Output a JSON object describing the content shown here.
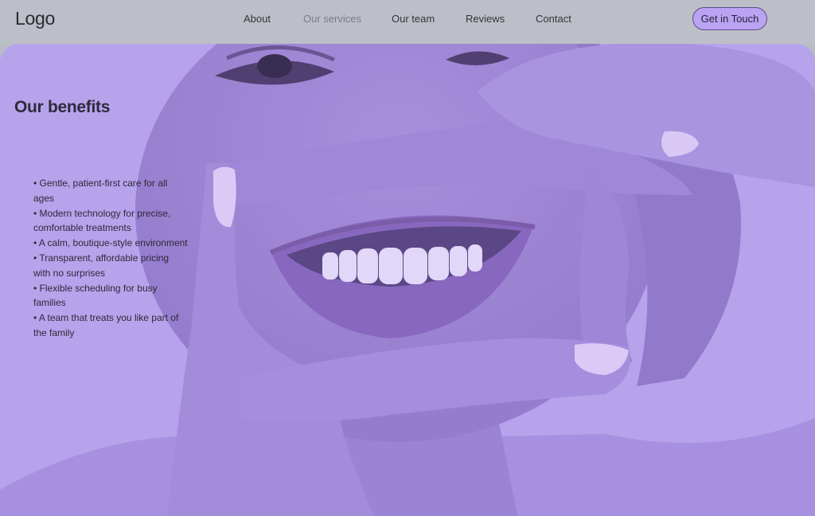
{
  "header": {
    "logo": "Logo",
    "nav": [
      {
        "label": "About",
        "active": false
      },
      {
        "label": "Our services",
        "active": true
      },
      {
        "label": "Our team",
        "active": false
      },
      {
        "label": "Reviews",
        "active": false
      },
      {
        "label": "Contact",
        "active": false
      }
    ],
    "cta_label": "Get in Touch"
  },
  "hero": {
    "title": "Our benefits",
    "benefits": [
      "• Gentle, patient-first care for all ages",
      "• Modern technology for precise, comfortable treatments",
      "• A calm, boutique-style environment",
      "• Transparent, affordable pricing with no surprises",
      "• Flexible scheduling for busy families",
      "• A team that treats you like part of the family"
    ]
  },
  "colors": {
    "header_bg": "#bcbfc8",
    "hero_tint": "#b7a4ea",
    "cta_bg": "#b9a3f2",
    "cta_border": "#5f4c86"
  }
}
